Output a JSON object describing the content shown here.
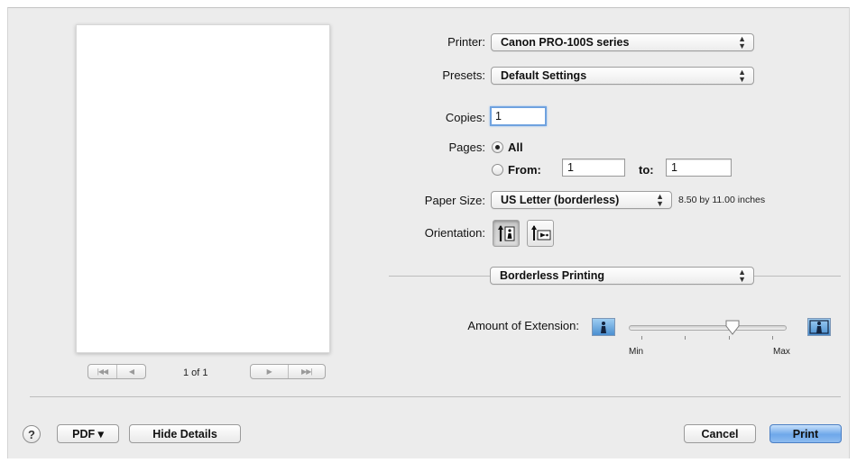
{
  "printer": {
    "label": "Printer:",
    "value": "Canon PRO-100S series"
  },
  "presets": {
    "label": "Presets:",
    "value": "Default Settings"
  },
  "copies": {
    "label": "Copies:",
    "value": "1"
  },
  "pages": {
    "label": "Pages:",
    "all_label": "All",
    "from_label": "From:",
    "from_value": "1",
    "to_label": "to:",
    "to_value": "1",
    "selected": "All"
  },
  "paper_size": {
    "label": "Paper Size:",
    "value": "US Letter (borderless)",
    "dimensions": "8.50 by 11.00 inches"
  },
  "orientation": {
    "label": "Orientation:",
    "selected": "portrait"
  },
  "section": {
    "value": "Borderless Printing"
  },
  "extension": {
    "label": "Amount of Extension:",
    "min_label": "Min",
    "max_label": "Max",
    "value_fraction": 0.67,
    "tick_count": 4
  },
  "preview": {
    "page_count": "1 of 1"
  },
  "footer": {
    "help_glyph": "?",
    "pdf_label": "PDF ▾",
    "hide_details_label": "Hide Details",
    "cancel_label": "Cancel",
    "print_label": "Print"
  },
  "colors": {
    "default_button": "#6ea8ea",
    "focus_ring": "#6fa2df",
    "icon_blue": "#4b8fd0"
  },
  "icons": {
    "first_page": "first-page-icon",
    "prev_page": "previous-page-icon",
    "next_page": "next-page-icon",
    "last_page": "last-page-icon",
    "portrait": "portrait-orientation-icon",
    "landscape": "landscape-orientation-icon",
    "extension_min": "extension-min-icon",
    "extension_max": "extension-max-icon",
    "help": "help-icon"
  }
}
